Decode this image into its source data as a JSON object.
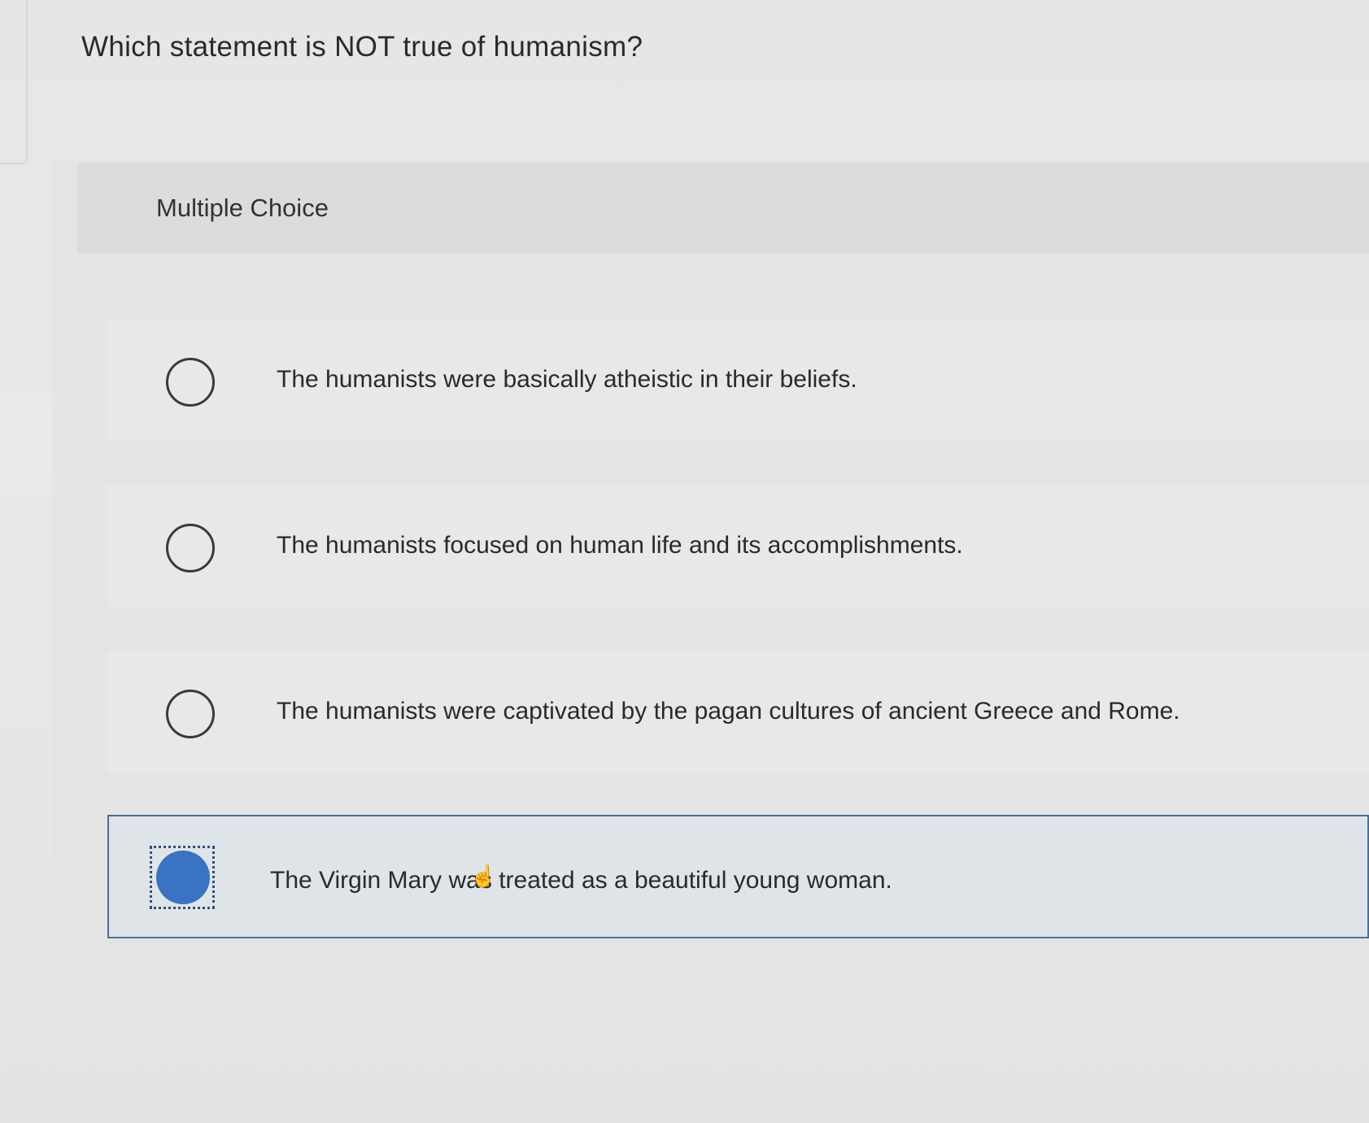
{
  "question": {
    "text": "Which statement is NOT true of humanism?"
  },
  "answer_area": {
    "type_label": "Multiple Choice"
  },
  "options": [
    {
      "text": "The humanists were basically atheistic in their beliefs.",
      "selected": false
    },
    {
      "text": "The humanists focused on human life and its accomplishments.",
      "selected": false
    },
    {
      "text": "The humanists were captivated by the pagan cultures of ancient Greece and Rome.",
      "selected": false
    },
    {
      "text": "The Virgin Mary was treated as a beautiful young woman.",
      "selected": true
    }
  ],
  "colors": {
    "selected_radio": "#3a73c4",
    "selected_border": "#4a6ea0",
    "selected_background": "#dfe4e8"
  },
  "icons": {
    "cursor": "hand-pointer-icon"
  }
}
